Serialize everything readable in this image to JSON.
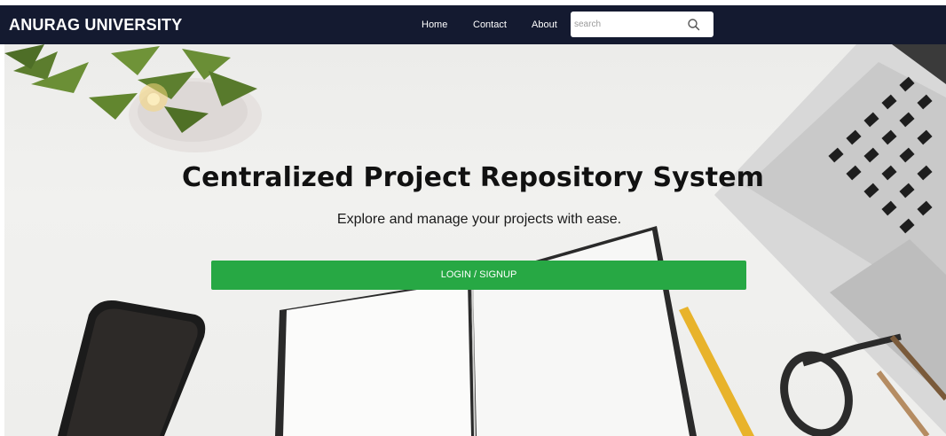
{
  "navbar": {
    "brand": "ANURAG UNIVERSITY",
    "links": [
      {
        "label": "Home"
      },
      {
        "label": "Contact"
      },
      {
        "label": "About"
      }
    ],
    "search": {
      "placeholder": "search",
      "value": "",
      "icon": "search-icon"
    }
  },
  "hero": {
    "title": "Centralized Project Repository System",
    "subtitle": "Explore and manage your projects with ease.",
    "cta_label": "LOGIN / SIGNUP"
  },
  "colors": {
    "navbar_bg": "#141a30",
    "cta_bg": "#27a844",
    "text_dark": "#111111"
  },
  "background_items": [
    "plant-image",
    "laptop-image",
    "notebook-image",
    "phone-image",
    "pencil-image",
    "glasses-image"
  ]
}
